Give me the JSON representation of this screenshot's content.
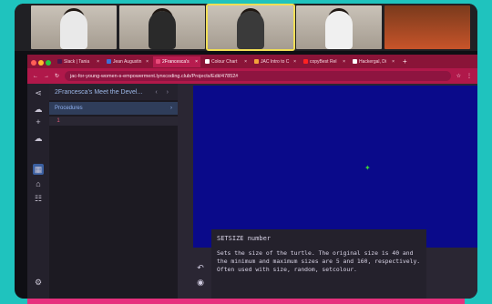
{
  "browser": {
    "tabs": [
      {
        "label": "Slack | Tania",
        "color": "#4a154b"
      },
      {
        "label": "Jean Augustin",
        "color": "#3d6fd6"
      },
      {
        "label": "2Francesca's",
        "color": "#e84b7a",
        "active": true
      },
      {
        "label": "Colour Chart",
        "color": "#ffffff"
      },
      {
        "label": "JAC Intro to C",
        "color": "#f2a23a"
      },
      {
        "label": "copyBest Rel",
        "color": "#ff2222"
      },
      {
        "label": "Hackergal, Di",
        "color": "#ffffff"
      }
    ],
    "url": "jac-for-young-women-s-empowerment.lynxcoding.club/Projects/Edit/47852#"
  },
  "project": {
    "title": "2Francesca's Meet the Devel...",
    "procedures_label": "Procedures",
    "line_number": "1"
  },
  "help": {
    "title": "SETSIZE number",
    "body": "Sets the size of the turtle. The original size is 40 and the minimum and maximum sizes are 5 and 160, respectively.\nOften used with size, random, setcolour."
  },
  "colors": {
    "canvas": "#0a0a8a",
    "turtle": "#3bd23b",
    "browser_accent": "#b0184a"
  },
  "icons": {
    "turtle": "turtle-icon",
    "share": "share-icon",
    "cloud_upload": "cloud-upload-icon",
    "add": "plus-icon",
    "cloud_download": "cloud-download-icon",
    "settings": "gear-icon"
  }
}
